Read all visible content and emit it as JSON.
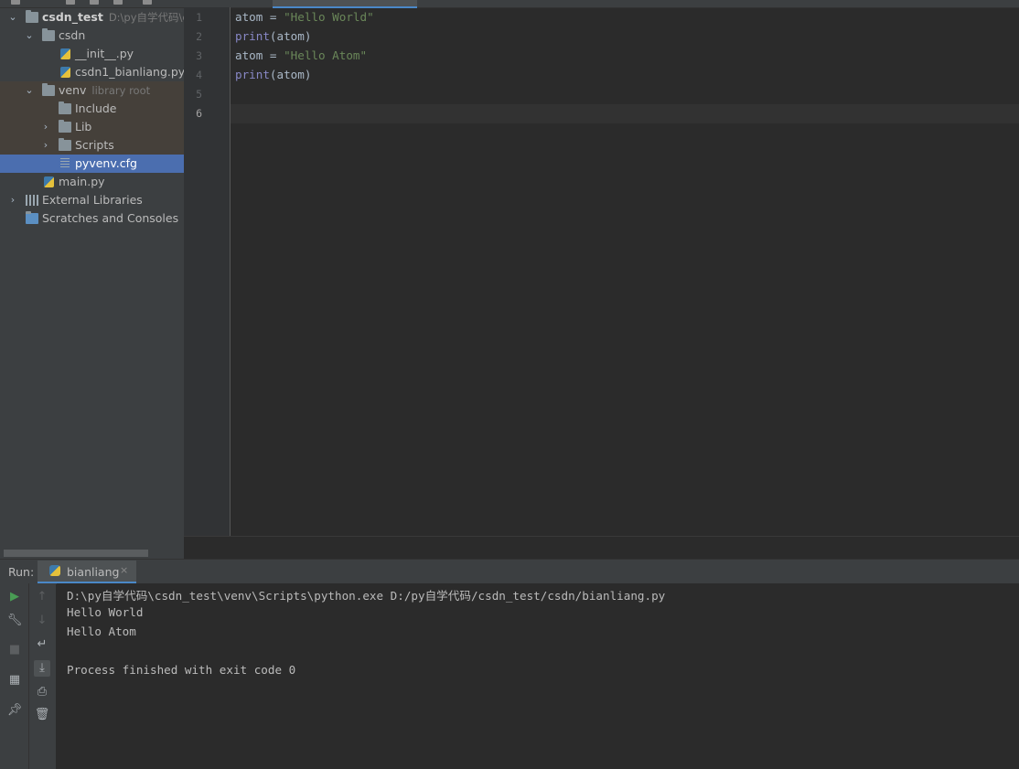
{
  "project_tree": {
    "root": {
      "label": "csdn_test",
      "hint": "D:\\py自学代码\\cs"
    },
    "items": [
      {
        "label": "csdn"
      },
      {
        "label": "__init__.py"
      },
      {
        "label": "csdn1_bianliang.py"
      },
      {
        "label": "venv",
        "hint": "library root"
      },
      {
        "label": "Include"
      },
      {
        "label": "Lib"
      },
      {
        "label": "Scripts"
      },
      {
        "label": "pyvenv.cfg"
      },
      {
        "label": "main.py"
      },
      {
        "label": "External Libraries"
      },
      {
        "label": "Scratches and Consoles"
      }
    ]
  },
  "editor": {
    "line_numbers": [
      "1",
      "2",
      "3",
      "4",
      "5",
      "6"
    ],
    "current_line": "6",
    "lines": [
      {
        "var": "atom",
        "op": " = ",
        "str": "\"Hello World\""
      },
      {
        "fn": "print",
        "args": "(atom)"
      },
      {
        "var": "atom",
        "op": " = ",
        "str": "\"Hello Atom\""
      },
      {
        "fn": "print",
        "args": "(atom)"
      }
    ]
  },
  "run_panel": {
    "label": "Run:",
    "tab_label": "bianliang",
    "tab_close": "×",
    "console": [
      "D:\\py自学代码\\csdn_test\\venv\\Scripts\\python.exe D:/py自学代码/csdn_test/csdn/bianliang.py",
      "Hello World",
      "Hello Atom",
      "",
      "Process finished with exit code 0"
    ],
    "tools_left": [
      "run-icon",
      "wrench-icon",
      "stop-icon",
      "layout-icon",
      "pin-icon"
    ],
    "tools_right": [
      "up-arrow-icon",
      "down-arrow-icon",
      "soft-wrap-icon",
      "scroll-to-end-icon",
      "print-icon",
      "trash-icon"
    ]
  },
  "colors": {
    "background": "#2b2b2b",
    "panel": "#3c3f41",
    "selection": "#4b6eaf",
    "keyword": "#8888c6",
    "string": "#6a8759"
  }
}
